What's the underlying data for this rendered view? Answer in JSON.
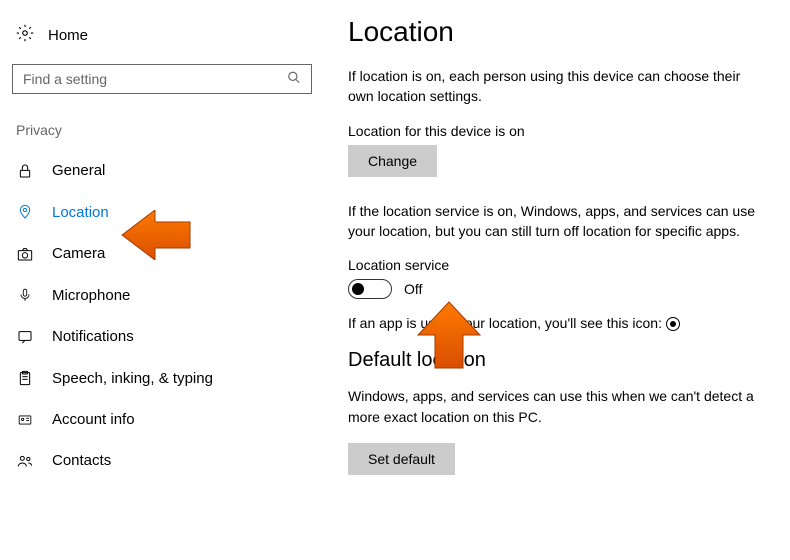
{
  "sidebar": {
    "home_label": "Home",
    "search": {
      "placeholder": "Find a setting"
    },
    "section_label": "Privacy",
    "items": [
      {
        "label": "General"
      },
      {
        "label": "Location"
      },
      {
        "label": "Camera"
      },
      {
        "label": "Microphone"
      },
      {
        "label": "Notifications"
      },
      {
        "label": "Speech, inking, & typing"
      },
      {
        "label": "Account info"
      },
      {
        "label": "Contacts"
      }
    ]
  },
  "main": {
    "title": "Location",
    "intro": "If location is on, each person using this device can choose their own location settings.",
    "device_status_label": "Location for this device is on",
    "change_button": "Change",
    "service_desc": "If the location service is on, Windows, apps, and services can use your location, but you can still turn off location for specific apps.",
    "service_label": "Location service",
    "toggle_state": "Off",
    "in_use_text_pre": "If an app is using your location, you'll see this icon:",
    "default_heading": "Default location",
    "default_desc": "Windows, apps, and services can use this when we can't detect a more exact location on this PC.",
    "set_default_button": "Set default"
  }
}
